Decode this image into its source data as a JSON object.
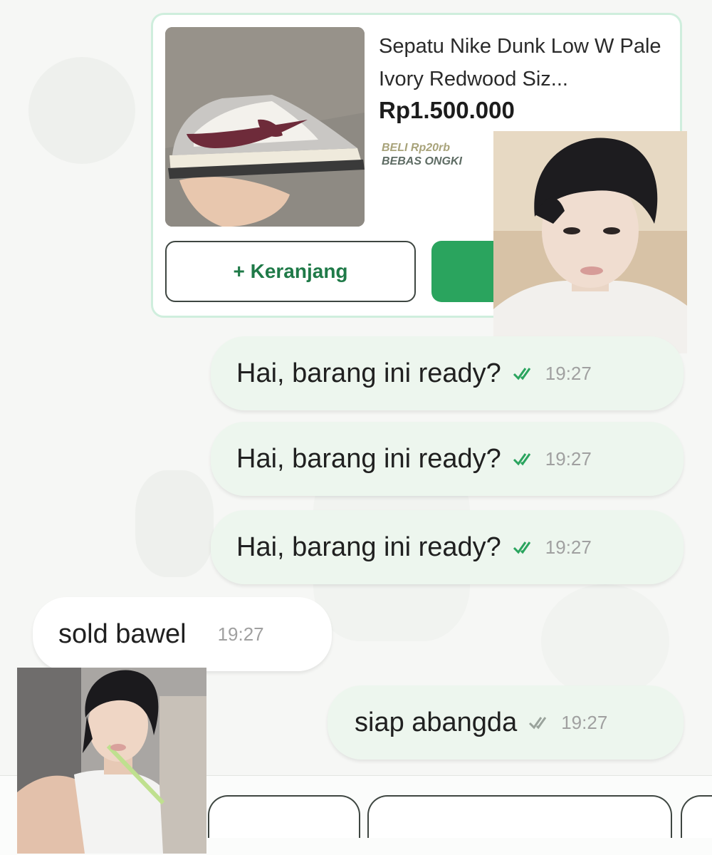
{
  "product": {
    "title": "Sepatu Nike Dunk Low W Pale Ivory Redwood Siz...",
    "price": "Rp1.500.000",
    "promo_line1": "BELI Rp20rb",
    "promo_line2": "BEBAS ONGKI",
    "cart_button_label": "+ Keranjang",
    "colors": {
      "accent_green": "#2aa45e",
      "cart_text": "#1f7a48",
      "card_border": "#cfeedd"
    }
  },
  "messages": [
    {
      "direction": "outgoing",
      "text": "Hai, barang ini ready?",
      "time": "19:27",
      "status_icon": "double-check-icon"
    },
    {
      "direction": "outgoing",
      "text": "Hai, barang ini ready?",
      "time": "19:27",
      "status_icon": "double-check-icon"
    },
    {
      "direction": "outgoing",
      "text": "Hai, barang ini ready?",
      "time": "19:27",
      "status_icon": "double-check-icon"
    },
    {
      "direction": "incoming",
      "text": "sold bawel",
      "time": "19:27"
    },
    {
      "direction": "outgoing",
      "text": "siap abangda",
      "time": "19:27",
      "status_icon": "double-check-icon"
    }
  ],
  "colors": {
    "outgoing_bubble": "#edf6ee",
    "incoming_bubble": "#ffffff",
    "read_check": "#2aa45e",
    "sent_check": "#9aa39c",
    "time_text": "#a0a0a0"
  }
}
